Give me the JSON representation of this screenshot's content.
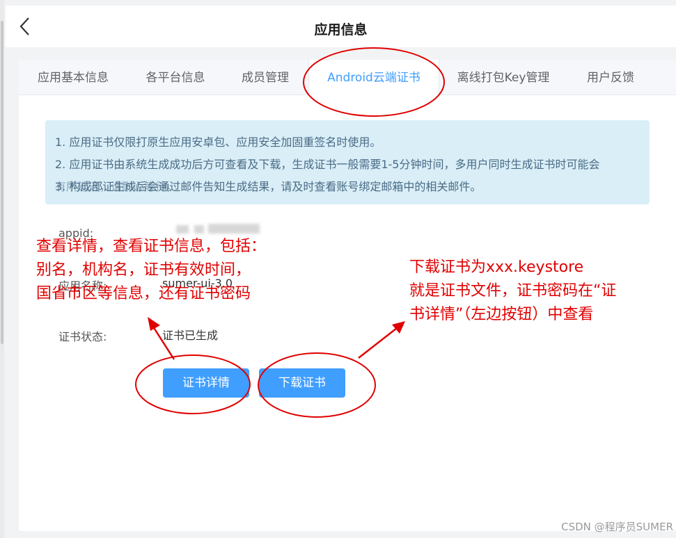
{
  "header": {
    "title": "应用信息"
  },
  "tabs": [
    {
      "label": "应用基本信息",
      "active": false
    },
    {
      "label": "各平台信息",
      "active": false
    },
    {
      "label": "成员管理",
      "active": false
    },
    {
      "label": "Android云端证书",
      "active": true
    },
    {
      "label": "离线打包Key管理",
      "active": false
    },
    {
      "label": "用户反馈",
      "active": false
    }
  ],
  "notice": {
    "line1": "1. 应用证书仅限打原生应用安卓包、应用安全加固重签名时使用。",
    "line2": "2. 应用证书由系统生成成功后方可查看及下载，生成证书一般需要1-5分钟时间，多用户同时生成证书时可能会",
    "line3a": "3. 构成部证生成后会通过邮件告知生成结果，请及时查看账号绑定邮箱中的相关邮件。",
    "line3b": "有所延迟，请耐心等待。"
  },
  "fields": {
    "appid_label": "appid:",
    "app_name_label": "应用名称:",
    "app_name_value": "sumer-ui-3.0",
    "status_label": "证书状态:",
    "status_value": "证书已生成"
  },
  "buttons": {
    "detail": "证书详情",
    "download": "下载证书"
  },
  "annotations": {
    "left_lines": [
      "查看详情，查看证书信息，包括：",
      "别名，机构名，证书有效时间，",
      "国省市区等信息，还有证书密码"
    ],
    "right_lines": [
      "下载证书为xxx.keystore",
      "就是证书文件，证书密码在“证",
      "书详情”（左边按钮）中查看"
    ]
  },
  "watermark": "CSDN @程序员SUMER",
  "colors": {
    "accent": "#409eff",
    "annotation": "#e00000",
    "notice_bg": "#d9eef7"
  }
}
